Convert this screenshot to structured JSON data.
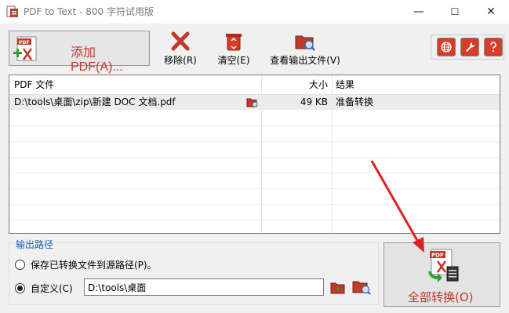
{
  "window": {
    "title": "PDF to Text - 800 字符试用版",
    "minimize": "—",
    "maximize": "☐",
    "close": "✕"
  },
  "toolbar": {
    "add_pdf_label": "添加 PDF(A)...",
    "remove_label": "移除(R)",
    "clear_label": "清空(E)",
    "view_output_label": "查看输出文件(V)"
  },
  "file_list": {
    "columns": [
      "PDF 文件",
      "大小",
      "结果"
    ],
    "rows": [
      {
        "file": "D:\\tools\\桌面\\zip\\新建 DOC 文档.pdf",
        "size": "49 KB",
        "result": "准备转换"
      }
    ]
  },
  "output": {
    "legend": "输出路径",
    "option_source": "保存已转换文件到源路径(P)。",
    "option_custom": "自定义(C)",
    "custom_path": "D:\\tools\\桌面",
    "selected": "custom"
  },
  "convert": {
    "label": "全部转换(O)",
    "icon_badge": "PDF"
  },
  "icons": {
    "add_badge": "PDF"
  },
  "colors": {
    "accent_red": "#c0392b",
    "legend_blue": "#1a5fb4",
    "annotation_arrow": "#e02020"
  }
}
